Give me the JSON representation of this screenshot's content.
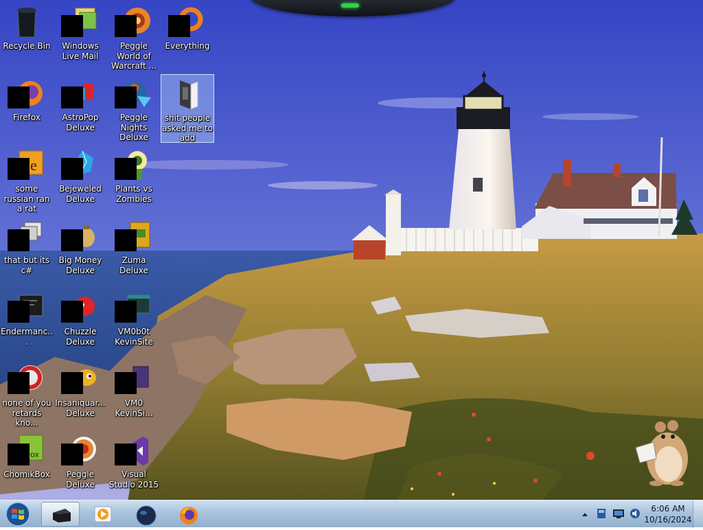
{
  "desktop": {
    "icons": [
      {
        "label": "Recycle Bin",
        "icon": "recycle-bin-icon"
      },
      {
        "label": "Windows Live Mail",
        "icon": "mail-icon"
      },
      {
        "label": "Peggle World of Warcraft ...",
        "icon": "peggle-wow-icon"
      },
      {
        "label": "Everything",
        "icon": "search-ring-icon"
      },
      {
        "label": "Firefox",
        "icon": "firefox-icon"
      },
      {
        "label": "AstroPop Deluxe",
        "icon": "astropop-icon"
      },
      {
        "label": "Peggle Nights Deluxe",
        "icon": "peggle-nights-icon"
      },
      {
        "label": "shit people asked me to add",
        "icon": "folder-icon"
      },
      {
        "label": "some russian ran a rat",
        "icon": "orange-app-icon"
      },
      {
        "label": "Bejeweled Deluxe",
        "icon": "bejeweled-icon"
      },
      {
        "label": "Plants vs Zombies",
        "icon": "plants-vs-zombies-icon"
      },
      {
        "label": "that but its c#",
        "icon": "stacked-windows-icon"
      },
      {
        "label": "Big Money Deluxe",
        "icon": "money-bag-icon"
      },
      {
        "label": "Zuma Deluxe",
        "icon": "zuma-icon"
      },
      {
        "label": "Endermanc...",
        "icon": "console-icon"
      },
      {
        "label": "Chuzzle Deluxe",
        "icon": "chuzzle-icon"
      },
      {
        "label": "VM0b0t KevinSite",
        "icon": "vm-window-icon"
      },
      {
        "label": "none of you retards kno...",
        "icon": "opera-icon"
      },
      {
        "label": "Insaniquar... Deluxe",
        "icon": "fish-icon"
      },
      {
        "label": "VM0 KevinSi...",
        "icon": "vm-app-icon"
      },
      {
        "label": "ChomikBox",
        "icon": "chomikbox-icon"
      },
      {
        "label": "Peggle Deluxe",
        "icon": "peggle-icon"
      },
      {
        "label": "Visual Studio 2015",
        "icon": "visual-studio-icon"
      }
    ],
    "selected_icon": "shit people asked me to add"
  },
  "taskbar": {
    "pinned": [
      {
        "name": "explorer-window",
        "icon": "window-icon",
        "active": true
      },
      {
        "name": "media-player",
        "icon": "media-player-icon",
        "active": false
      },
      {
        "name": "globe-app",
        "icon": "globe-icon",
        "active": false
      },
      {
        "name": "firefox",
        "icon": "firefox-icon",
        "active": false
      }
    ],
    "clock": {
      "time": "6:06 AM",
      "date": "10/16/2024"
    }
  },
  "colors": {
    "sky_top": "#3a4fc8",
    "sky_bottom": "#9aa6e6",
    "sea": "#2d4d97",
    "grass": "#b5893a",
    "taskbar": "#a9c3dc",
    "selection": "#bedcff"
  }
}
